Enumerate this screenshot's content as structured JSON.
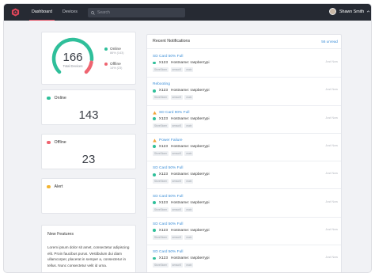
{
  "nav": {
    "items": [
      {
        "label": "Dashboard",
        "active": true
      },
      {
        "label": "Devices",
        "active": false
      }
    ],
    "search_placeholder": "Search",
    "user_name": "Shawn Smith"
  },
  "gauge": {
    "total": "166",
    "total_label": "Total Devices",
    "online_fraction": 0.86,
    "legend": [
      {
        "label": "Online",
        "detail": "86% (143)",
        "color": "#2fbf9a"
      },
      {
        "label": "Offline",
        "detail": "14% (23)",
        "color": "#ef6470"
      }
    ]
  },
  "stats": [
    {
      "label": "Online",
      "value": "143",
      "color": "#2fbf9a"
    },
    {
      "label": "Offline",
      "value": "23",
      "color": "#ef6470"
    },
    {
      "label": "Alert",
      "value": "",
      "color": "#f2b431"
    }
  ],
  "features": {
    "title": "New Features",
    "body": "Lorem ipsum dolor sit amet, consectetur adipiscing elit. Proin faucibus purus. Vestibulum dui diam ullamcorper, placerat in semper a, consectetur in tellus. Nunc consectetur velit id urna."
  },
  "notifications": {
    "title": "Recent Notifications",
    "unread_label": "56 unread",
    "items": [
      {
        "title": "SD Card 50% Full",
        "warning": false,
        "id": "X123",
        "hostname": "Hostname: raspberrypi",
        "tags": [
          "StoreStorm",
          "sensor5",
          "main"
        ],
        "time": "Just Now"
      },
      {
        "title": "Rebooting",
        "warning": false,
        "id": "X123",
        "hostname": "Hostname: raspberrypi",
        "tags": [
          "StoreStorm",
          "sensor5",
          "main"
        ],
        "time": "Just Now"
      },
      {
        "title": "SD Card 90% Full",
        "warning": true,
        "id": "X123",
        "hostname": "Hostname: raspberrypi",
        "tags": [
          "StoreStorm",
          "sensor5",
          "main"
        ],
        "time": "Just Now"
      },
      {
        "title": "Power Failure",
        "warning": true,
        "id": "X123",
        "hostname": "Hostname: raspberrypi",
        "tags": [
          "StoreStorm",
          "sensor5",
          "main"
        ],
        "time": "Just Now"
      },
      {
        "title": "SD Card 50% Full",
        "warning": false,
        "id": "X123",
        "hostname": "Hostname: raspberrypi",
        "tags": [
          "StoreStorm",
          "sensor5",
          "main"
        ],
        "time": "Just Now"
      },
      {
        "title": "SD Card 50% Full",
        "warning": false,
        "id": "X123",
        "hostname": "Hostname: raspberrypi",
        "tags": [
          "StoreStorm",
          "sensor5",
          "main"
        ],
        "time": "Just Now"
      },
      {
        "title": "SD Card 50% Full",
        "warning": false,
        "id": "X123",
        "hostname": "Hostname: raspberrypi",
        "tags": [
          "StoreStorm",
          "sensor5",
          "main"
        ],
        "time": "Just Now"
      },
      {
        "title": "SD Card 50% Full",
        "warning": false,
        "id": "X123",
        "hostname": "Hostname: raspberrypi",
        "tags": [
          "StoreStorm",
          "sensor5",
          "main"
        ],
        "time": "Just Now"
      }
    ]
  },
  "colors": {
    "accent": "#e0465a",
    "link": "#3d8fd8",
    "online": "#2fbf9a",
    "offline": "#ef6470",
    "alert": "#f2b431",
    "topbar": "#262a33"
  }
}
